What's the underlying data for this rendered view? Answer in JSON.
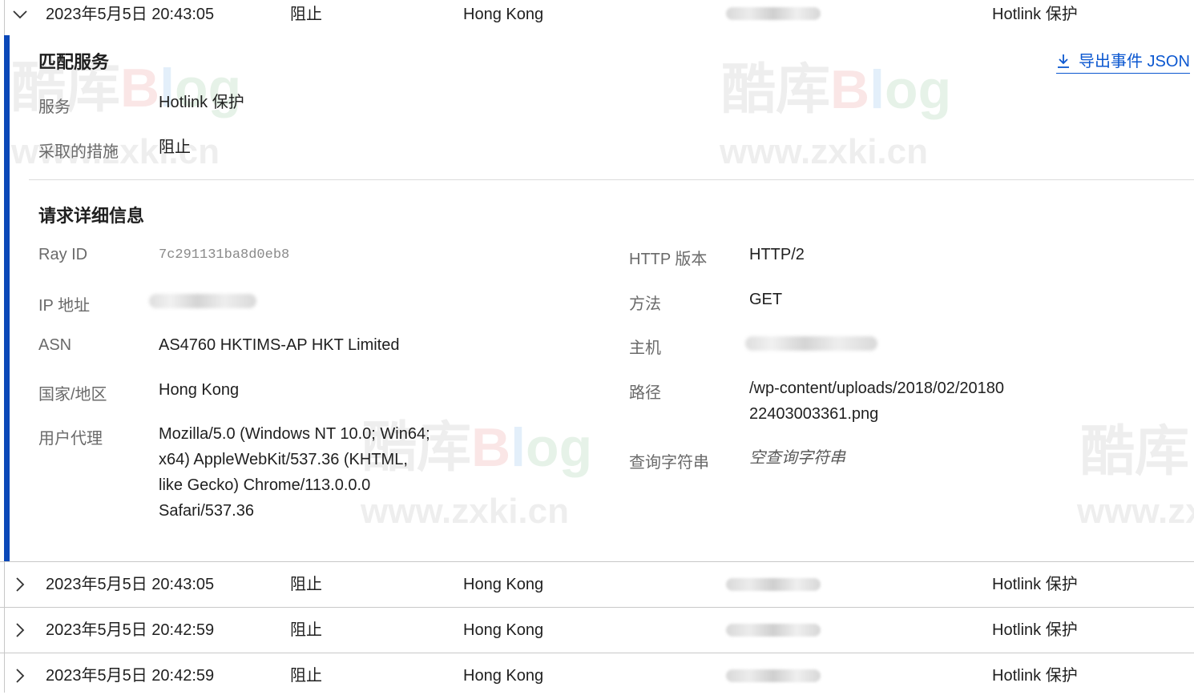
{
  "events": [
    {
      "datetime": "2023年5月5日 20:43:05",
      "action": "阻止",
      "country": "Hong Kong",
      "service": "Hotlink 保护",
      "expanded": true
    },
    {
      "datetime": "2023年5月5日 20:43:05",
      "action": "阻止",
      "country": "Hong Kong",
      "service": "Hotlink 保护",
      "expanded": false
    },
    {
      "datetime": "2023年5月5日 20:42:59",
      "action": "阻止",
      "country": "Hong Kong",
      "service": "Hotlink 保护",
      "expanded": false
    },
    {
      "datetime": "2023年5月5日 20:42:59",
      "action": "阻止",
      "country": "Hong Kong",
      "service": "Hotlink 保护",
      "expanded": false
    }
  ],
  "detail": {
    "export_label": "导出事件 JSON",
    "matched_service": {
      "title": "匹配服务",
      "service_label": "服务",
      "service_value": "Hotlink 保护",
      "action_label": "采取的措施",
      "action_value": "阻止"
    },
    "request": {
      "title": "请求详细信息",
      "ray_id_label": "Ray ID",
      "ray_id_value": "7c291131ba8d0eb8",
      "ip_label": "IP 地址",
      "asn_label": "ASN",
      "asn_value": "AS4760 HKTIMS-AP HKT Limited",
      "country_label": "国家/地区",
      "country_value": "Hong Kong",
      "ua_label": "用户代理",
      "ua_lines": [
        "Mozilla/5.0 (Windows NT 10.0; Win64;",
        "x64) AppleWebKit/537.36 (KHTML,",
        "like Gecko) Chrome/113.0.0.0",
        "Safari/537.36"
      ],
      "http_label": "HTTP 版本",
      "http_value": "HTTP/2",
      "method_label": "方法",
      "method_value": "GET",
      "host_label": "主机",
      "path_label": "路径",
      "path_lines": [
        "/wp-content/uploads/2018/02/20180",
        "22403003361.png"
      ],
      "query_label": "查询字符串",
      "query_value": "空查询字符串"
    }
  },
  "watermark": {
    "brand_cn": "酷库",
    "brand_en_b": "B",
    "brand_en_l": "l",
    "brand_en_og": "og",
    "url": "www.zxki.cn"
  },
  "colors": {
    "accent_bar": "#0b48b8",
    "link": "#0b57d0"
  }
}
